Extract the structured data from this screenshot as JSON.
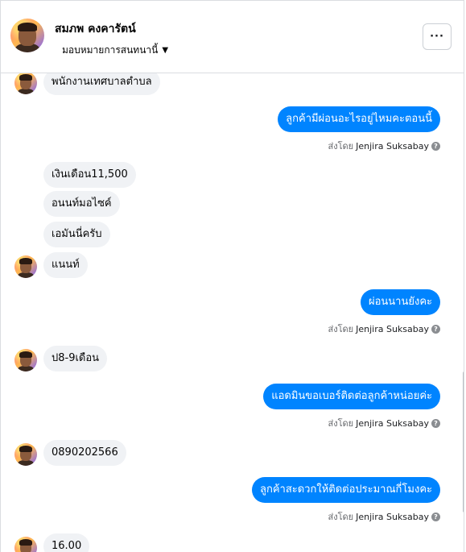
{
  "header": {
    "name": "สมภพ คงคารัตน์",
    "assign_label": "มอบหมายการสนทนานี้",
    "more_label": "···"
  },
  "messages": {
    "m1": "พนักงานเทศบาลตำบล",
    "m2": "ลูกค้ามีผ่อนอะไรอยู่ไหมคะตอนนี้",
    "m3": "เงินเดือน11,500",
    "m4": "อนนท์มอไซค์",
    "m5": "เอมันนี่ครับ",
    "m6": "แนนท์",
    "m7": "ผ่อนนานยังคะ",
    "m8": "ป8-9เดือน",
    "m9": "แอดมินขอเบอร์ติดต่อลูกค้าหน่อยค่ะ",
    "m10": "0890202566",
    "m11": "ลูกค้าสะดวกให้ติดต่อประมาณกี่โมงคะ",
    "m12": "16.00"
  },
  "sent_by": {
    "prefix": "ส่งโดย",
    "agent": "Jenjira Suksabay"
  }
}
